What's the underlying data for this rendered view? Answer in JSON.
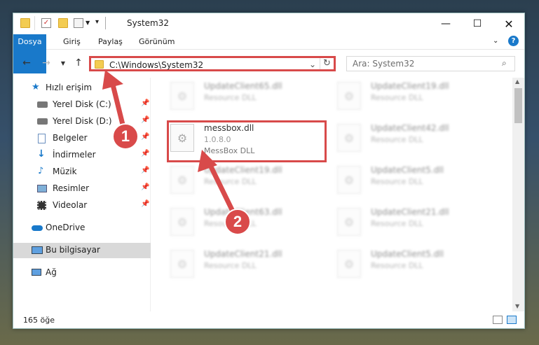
{
  "window": {
    "title": "System32"
  },
  "ribbon": {
    "tabs": [
      "Dosya",
      "Giriş",
      "Paylaş",
      "Görünüm"
    ]
  },
  "address": {
    "path": "C:\\Windows\\System32"
  },
  "search": {
    "placeholder": "Ara: System32"
  },
  "nav": {
    "items": [
      {
        "label": "Hızlı erişim",
        "icon": "star-icon"
      },
      {
        "label": "Yerel Disk (C:)",
        "icon": "drive-icon",
        "pinned": true
      },
      {
        "label": "Yerel Disk (D:)",
        "icon": "drive-icon",
        "pinned": true
      },
      {
        "label": "Belgeler",
        "icon": "documents-icon",
        "pinned": true
      },
      {
        "label": "İndirmeler",
        "icon": "download-icon",
        "pinned": true
      },
      {
        "label": "Müzik",
        "icon": "music-icon",
        "pinned": true
      },
      {
        "label": "Resimler",
        "icon": "pictures-icon",
        "pinned": true
      },
      {
        "label": "Videolar",
        "icon": "videos-icon",
        "pinned": true
      },
      {
        "label": "OneDrive",
        "icon": "cloud-icon"
      },
      {
        "label": "Bu bilgisayar",
        "icon": "computer-icon",
        "selected": true
      },
      {
        "label": "Ağ",
        "icon": "network-icon"
      }
    ]
  },
  "files": {
    "selected": {
      "name": "messbox.dll",
      "version": "1.0.8.0",
      "desc": "MessBox DLL"
    },
    "col1": [
      {
        "name": "UpdateClient65.dll",
        "desc": "Resource DLL"
      },
      {
        "name": "UpdateClient19.dll",
        "desc": "Resource DLL"
      },
      {
        "name": "UpdateClient63.dll",
        "desc": "Resource DLL"
      },
      {
        "name": "UpdateClient21.dll",
        "desc": "Resource DLL"
      }
    ],
    "col2": [
      {
        "name": "UpdateClient19.dll",
        "desc": "Resource DLL"
      },
      {
        "name": "UpdateClient42.dll",
        "desc": "Resource DLL"
      },
      {
        "name": "UpdateClient5.dll",
        "desc": "Resource DLL"
      },
      {
        "name": "UpdateClient21.dll",
        "desc": "Resource DLL"
      },
      {
        "name": "UpdateClient5.dll",
        "desc": "Resource DLL"
      }
    ]
  },
  "status": {
    "count": "165 öğe"
  },
  "markers": {
    "one": "1",
    "two": "2"
  },
  "colors": {
    "accent": "#1979ca",
    "highlight": "#d84a4a"
  }
}
